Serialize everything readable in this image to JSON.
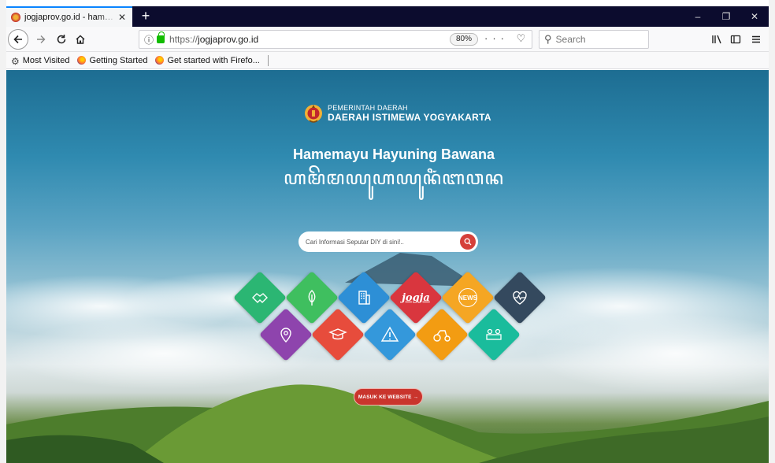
{
  "browser": {
    "tab_title": "jogjaprov.go.id - hamemayu ha",
    "tab_close": "✕",
    "new_tab": "+",
    "minimize": "–",
    "restore": "❐",
    "close": "✕",
    "url_prefix": "https://",
    "url_host": "jogjaprov.go.id",
    "zoom": "80%",
    "page_actions": "··· ♡ ☆",
    "search_placeholder": "Search",
    "bookmarks": [
      "Most Visited",
      "Getting Started",
      "Get started with Firefo..."
    ]
  },
  "page": {
    "brand_line1": "PEMERINTAH DAERAH",
    "brand_line2": "DAERAH ISTIMEWA YOGYAKARTA",
    "motto": "Hamemayu Hayuning Bawana",
    "motto_script": "ꦲꦩꦼꦩꦪꦸꦲꦪꦸꦤꦶꦁꦧꦮꦤ",
    "search_placeholder": "Cari Informasi Seputar DIY di sini!..",
    "tiles_row1": [
      {
        "name": "handshake",
        "color": "#2bb673",
        "label": ""
      },
      {
        "name": "leaf",
        "color": "#3fbf5f",
        "label": ""
      },
      {
        "name": "building",
        "color": "#2d8fd6",
        "label": ""
      },
      {
        "name": "jogja",
        "color": "#d9363e",
        "label": "jogja"
      },
      {
        "name": "news",
        "color": "#f5a623",
        "label": "NEWS"
      },
      {
        "name": "heart-pulse",
        "color": "#34495e",
        "label": ""
      }
    ],
    "tiles_row2": [
      {
        "name": "map-pin",
        "color": "#8e44ad",
        "label": ""
      },
      {
        "name": "graduation",
        "color": "#e74c3c",
        "label": ""
      },
      {
        "name": "warning",
        "color": "#3498db",
        "label": ""
      },
      {
        "name": "tractor",
        "color": "#f39c12",
        "label": ""
      },
      {
        "name": "people",
        "color": "#1abc9c",
        "label": ""
      }
    ],
    "cta": "MASUK KE WEBSITE →"
  }
}
